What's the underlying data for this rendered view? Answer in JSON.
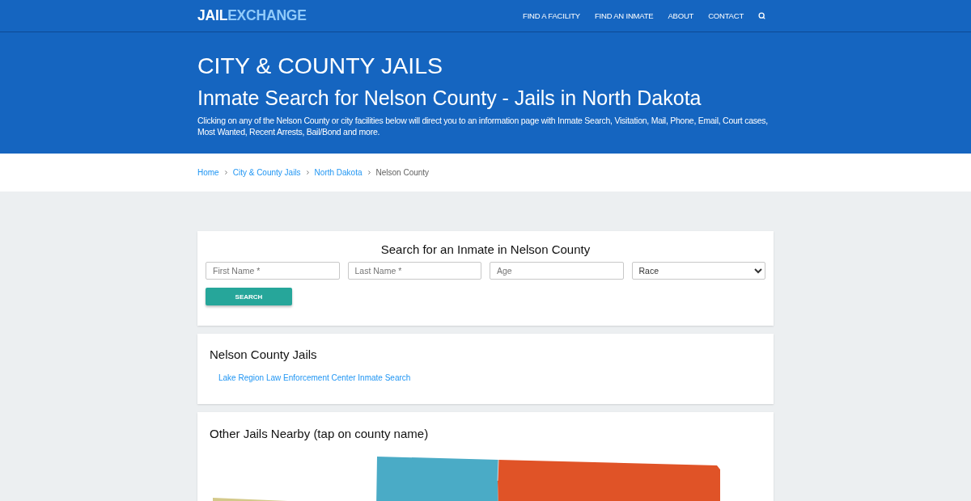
{
  "header": {
    "logo": {
      "primary": "JAIL",
      "secondary": "EXCHANGE"
    },
    "nav": [
      "FIND A FACILITY",
      "FIND AN INMATE",
      "ABOUT",
      "CONTACT"
    ]
  },
  "hero": {
    "category": "CITY & COUNTY JAILS",
    "title": "Inmate Search for Nelson County - Jails in North Dakota",
    "description": "Clicking on any of the Nelson County or city facilities below will direct you to an information page with Inmate Search, Visitation, Mail, Phone, Email, Court cases, Most Wanted, Recent Arrests, Bail/Bond and more."
  },
  "breadcrumb": [
    {
      "label": "Home",
      "kind": "link"
    },
    {
      "label": "City & County Jails",
      "kind": "link"
    },
    {
      "label": "North Dakota",
      "kind": "link"
    },
    {
      "label": "Nelson County",
      "kind": "current"
    }
  ],
  "search_form": {
    "title": "Search for an Inmate in Nelson County",
    "fields": [
      {
        "kind": "text",
        "placeholder": "First Name *"
      },
      {
        "kind": "text",
        "placeholder": "Last Name *"
      },
      {
        "kind": "text",
        "placeholder": "Age"
      },
      {
        "kind": "select",
        "value": "Race"
      }
    ],
    "button": "SEARCH"
  },
  "county_jails": {
    "title": "Nelson County Jails",
    "links": [
      "Lake Region Law Enforcement Center Inmate Search"
    ]
  },
  "nearby": {
    "title": "Other Jails Nearby (tap on county name)"
  }
}
